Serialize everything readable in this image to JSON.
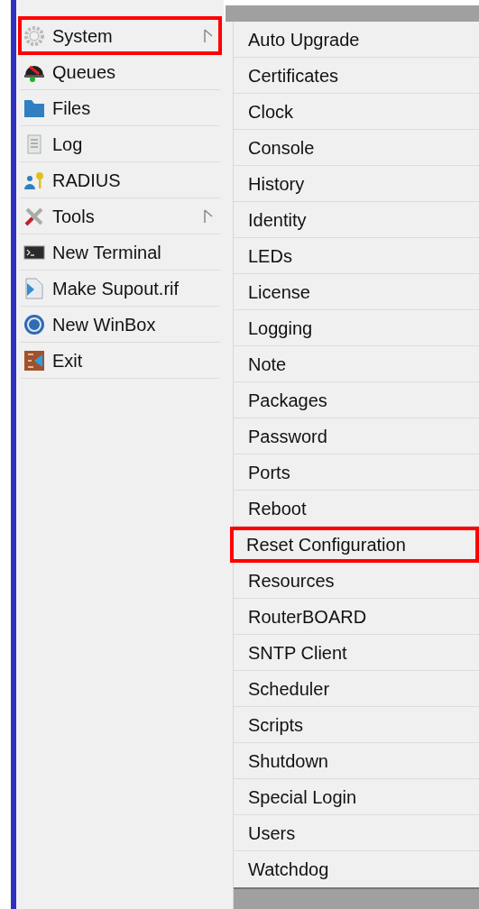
{
  "main_menu": {
    "items": [
      {
        "label": "System",
        "kind": "gear",
        "has_submenu": true,
        "highlighted": true
      },
      {
        "label": "Queues",
        "kind": "queue",
        "has_submenu": false,
        "highlighted": false
      },
      {
        "label": "Files",
        "kind": "folder",
        "has_submenu": false,
        "highlighted": false
      },
      {
        "label": "Log",
        "kind": "log",
        "has_submenu": false,
        "highlighted": false
      },
      {
        "label": "RADIUS",
        "kind": "radius",
        "has_submenu": false,
        "highlighted": false
      },
      {
        "label": "Tools",
        "kind": "tools",
        "has_submenu": true,
        "highlighted": false
      },
      {
        "label": "New Terminal",
        "kind": "terminal",
        "has_submenu": false,
        "highlighted": false
      },
      {
        "label": "Make Supout.rif",
        "kind": "supout",
        "has_submenu": false,
        "highlighted": false
      },
      {
        "label": "New WinBox",
        "kind": "winbox",
        "has_submenu": false,
        "highlighted": false
      },
      {
        "label": "Exit",
        "kind": "exit",
        "has_submenu": false,
        "highlighted": false
      }
    ]
  },
  "submenu": {
    "items": [
      {
        "label": "Auto Upgrade",
        "highlighted": false
      },
      {
        "label": "Certificates",
        "highlighted": false
      },
      {
        "label": "Clock",
        "highlighted": false
      },
      {
        "label": "Console",
        "highlighted": false
      },
      {
        "label": "History",
        "highlighted": false
      },
      {
        "label": "Identity",
        "highlighted": false
      },
      {
        "label": "LEDs",
        "highlighted": false
      },
      {
        "label": "License",
        "highlighted": false
      },
      {
        "label": "Logging",
        "highlighted": false
      },
      {
        "label": "Note",
        "highlighted": false
      },
      {
        "label": "Packages",
        "highlighted": false
      },
      {
        "label": "Password",
        "highlighted": false
      },
      {
        "label": "Ports",
        "highlighted": false
      },
      {
        "label": "Reboot",
        "highlighted": false
      },
      {
        "label": "Reset Configuration",
        "highlighted": true
      },
      {
        "label": "Resources",
        "highlighted": false
      },
      {
        "label": "RouterBOARD",
        "highlighted": false
      },
      {
        "label": "SNTP Client",
        "highlighted": false
      },
      {
        "label": "Scheduler",
        "highlighted": false
      },
      {
        "label": "Scripts",
        "highlighted": false
      },
      {
        "label": "Shutdown",
        "highlighted": false
      },
      {
        "label": "Special Login",
        "highlighted": false
      },
      {
        "label": "Users",
        "highlighted": false
      },
      {
        "label": "Watchdog",
        "highlighted": false
      }
    ]
  }
}
